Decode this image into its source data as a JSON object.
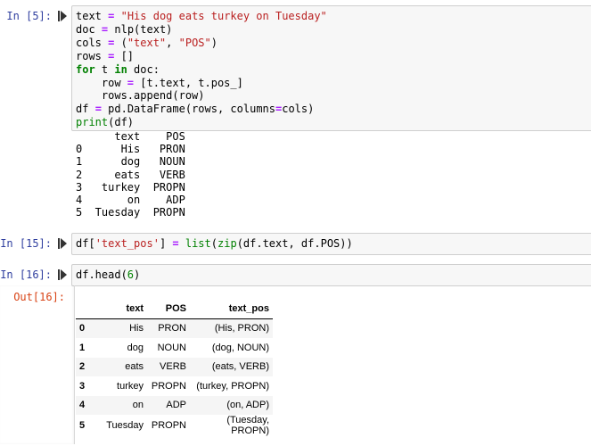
{
  "cells": [
    {
      "prompt": "In [5]:",
      "code": [
        "text = \"His dog eats turkey on Tuesday\"",
        "doc = nlp(text)",
        "cols = (\"text\", \"POS\")",
        "rows = []",
        "for t in doc:",
        "    row = [t.text, t.pos_]",
        "    rows.append(row)",
        "df = pd.DataFrame(rows, columns=cols)",
        "print(df)"
      ],
      "stdout": [
        "      text    POS",
        "0      His   PRON",
        "1      dog   NOUN",
        "2     eats   VERB",
        "3   turkey  PROPN",
        "4       on    ADP",
        "5  Tuesday  PROPN"
      ]
    },
    {
      "prompt": "In [15]:",
      "code": [
        "df['text_pos'] = list(zip(df.text, df.POS))"
      ]
    },
    {
      "prompt": "In [16]:",
      "code": [
        "df.head(6)"
      ],
      "out_prompt": "Out[16]:",
      "table": {
        "columns": [
          "",
          "text",
          "POS",
          "text_pos"
        ],
        "rows": [
          {
            "index": "0",
            "text": "His",
            "POS": "PRON",
            "text_pos": "(His, PRON)"
          },
          {
            "index": "1",
            "text": "dog",
            "POS": "NOUN",
            "text_pos": "(dog, NOUN)"
          },
          {
            "index": "2",
            "text": "eats",
            "POS": "VERB",
            "text_pos": "(eats, VERB)"
          },
          {
            "index": "3",
            "text": "turkey",
            "POS": "PROPN",
            "text_pos": "(turkey, PROPN)"
          },
          {
            "index": "4",
            "text": "on",
            "POS": "ADP",
            "text_pos": "(on, ADP)"
          },
          {
            "index": "5",
            "text": "Tuesday",
            "POS": "PROPN",
            "text_pos": "(Tuesday, PROPN)"
          }
        ]
      }
    }
  ],
  "colors": {
    "in_prompt": "#303F9F",
    "out_prompt": "#D84315",
    "keyword": "#008000",
    "string": "#BA2121",
    "cell_bg": "#f7f7f7"
  },
  "icons": {
    "run": "run-cell-icon"
  }
}
